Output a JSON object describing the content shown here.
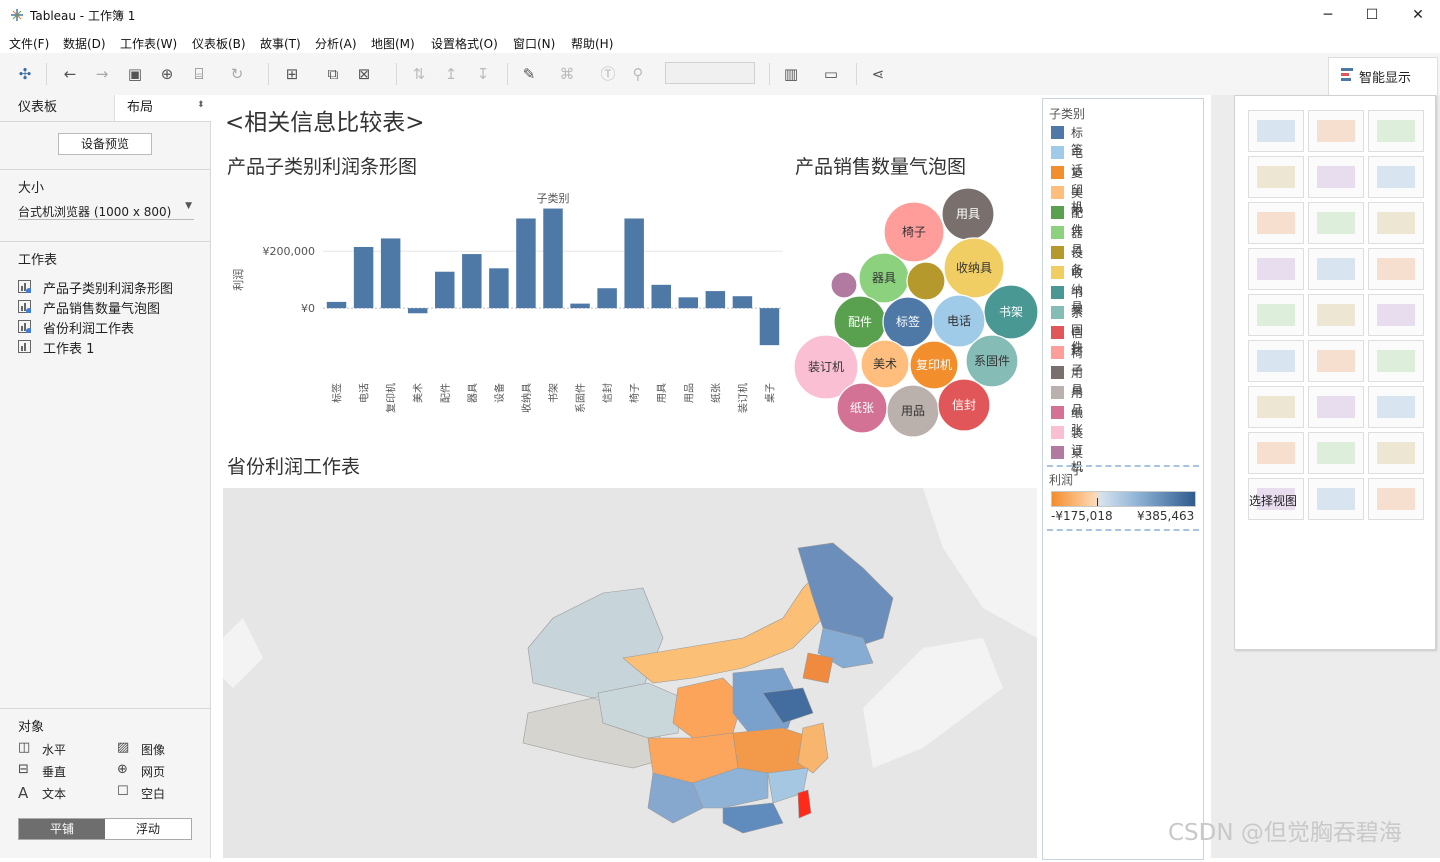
{
  "window": {
    "title": "Tableau - 工作簿 1"
  },
  "menu": [
    "文件(F)",
    "数据(D)",
    "工作表(W)",
    "仪表板(B)",
    "故事(T)",
    "分析(A)",
    "地图(M)",
    "设置格式(O)",
    "窗口(N)",
    "帮助(H)"
  ],
  "smart_show": {
    "label": "智能显示",
    "select_view": "选择视图"
  },
  "left_panel": {
    "tab_dashboard": "仪表板",
    "tab_layout": "布局",
    "device_preview": "设备预览",
    "size_label": "大小",
    "size_value": "台式机浏览器 (1000 x 800)",
    "sheets_label": "工作表",
    "sheets": [
      "产品子类别利润条形图",
      "产品销售数量气泡图",
      "省份利润工作表",
      "工作表 1"
    ],
    "objects_label": "对象",
    "objects": [
      "水平",
      "图像",
      "垂直",
      "网页",
      "文本",
      "空白"
    ],
    "tile_label": "平铺",
    "float_label": "浮动"
  },
  "dashboard": {
    "title": "<相关信息比较表>",
    "bar_title": "产品子类别利润条形图",
    "bubble_title": "产品销售数量气泡图",
    "map_title": "省份利润工作表"
  },
  "legend": {
    "category_title": "子类别",
    "profit_title": "利润",
    "profit_min": "-¥175,018",
    "profit_max": "¥385,463",
    "items": [
      {
        "name": "标签",
        "color": "#4e79a7"
      },
      {
        "name": "电话",
        "color": "#a0cbe8"
      },
      {
        "name": "复印机",
        "color": "#f28e2b"
      },
      {
        "name": "美术",
        "color": "#ffbe7d"
      },
      {
        "name": "配件",
        "color": "#59a14f"
      },
      {
        "name": "器具",
        "color": "#8cd17d"
      },
      {
        "name": "设备",
        "color": "#b6992d"
      },
      {
        "name": "收纳具",
        "color": "#f1ce63"
      },
      {
        "name": "书架",
        "color": "#499894"
      },
      {
        "name": "系固件",
        "color": "#86bcb6"
      },
      {
        "name": "信封",
        "color": "#e15759"
      },
      {
        "name": "椅子",
        "color": "#ff9d9a"
      },
      {
        "name": "用具",
        "color": "#79706e"
      },
      {
        "name": "用品",
        "color": "#bab0ac"
      },
      {
        "name": "纸张",
        "color": "#d37295"
      },
      {
        "name": "装订机",
        "color": "#fabfd2"
      },
      {
        "name": "桌子",
        "color": "#b07aa1"
      }
    ]
  },
  "chart_data": [
    {
      "type": "bar",
      "title": "",
      "xlabel": "子类别",
      "ylabel": "利润",
      "ylim": [
        -140000,
        380000
      ],
      "yticks": [
        0,
        200000
      ],
      "ytick_labels": [
        "¥0",
        "¥200,000"
      ],
      "categories": [
        "标签",
        "电话",
        "复印机",
        "美术",
        "配件",
        "器具",
        "设备",
        "收纳具",
        "书架",
        "系固件",
        "信封",
        "椅子",
        "用具",
        "用品",
        "纸张",
        "装订机",
        "桌子"
      ],
      "values": [
        22000,
        215000,
        245000,
        -18000,
        128000,
        190000,
        140000,
        315000,
        350000,
        16000,
        70000,
        315000,
        82000,
        38000,
        60000,
        42000,
        -130000
      ],
      "color": "#4e79a7"
    },
    {
      "type": "bubble",
      "title": "",
      "bubbles": [
        {
          "name": "用具",
          "size": 26,
          "color": "#79706e"
        },
        {
          "name": "椅子",
          "size": 30,
          "color": "#ff9d9a"
        },
        {
          "name": "收纳具",
          "size": 30,
          "color": "#f1ce63"
        },
        {
          "name": "器具",
          "size": 25,
          "color": "#8cd17d"
        },
        {
          "name": "设备",
          "size": 19,
          "color": "#b6992d"
        },
        {
          "name": "桌子",
          "size": 13,
          "color": "#b07aa1"
        },
        {
          "name": "书架",
          "size": 27,
          "color": "#499894"
        },
        {
          "name": "配件",
          "size": 26,
          "color": "#59a14f"
        },
        {
          "name": "标签",
          "size": 25,
          "color": "#4e79a7"
        },
        {
          "name": "电话",
          "size": 26,
          "color": "#a0cbe8"
        },
        {
          "name": "系固件",
          "size": 26,
          "color": "#86bcb6"
        },
        {
          "name": "装订机",
          "size": 32,
          "color": "#fabfd2"
        },
        {
          "name": "美术",
          "size": 24,
          "color": "#ffbe7d"
        },
        {
          "name": "复印机",
          "size": 24,
          "color": "#f28e2b"
        },
        {
          "name": "纸张",
          "size": 25,
          "color": "#d37295"
        },
        {
          "name": "用品",
          "size": 26,
          "color": "#bab0ac"
        },
        {
          "name": "信封",
          "size": 26,
          "color": "#e15759"
        }
      ]
    }
  ],
  "watermark": "CSDN @但觉胸吞碧海"
}
